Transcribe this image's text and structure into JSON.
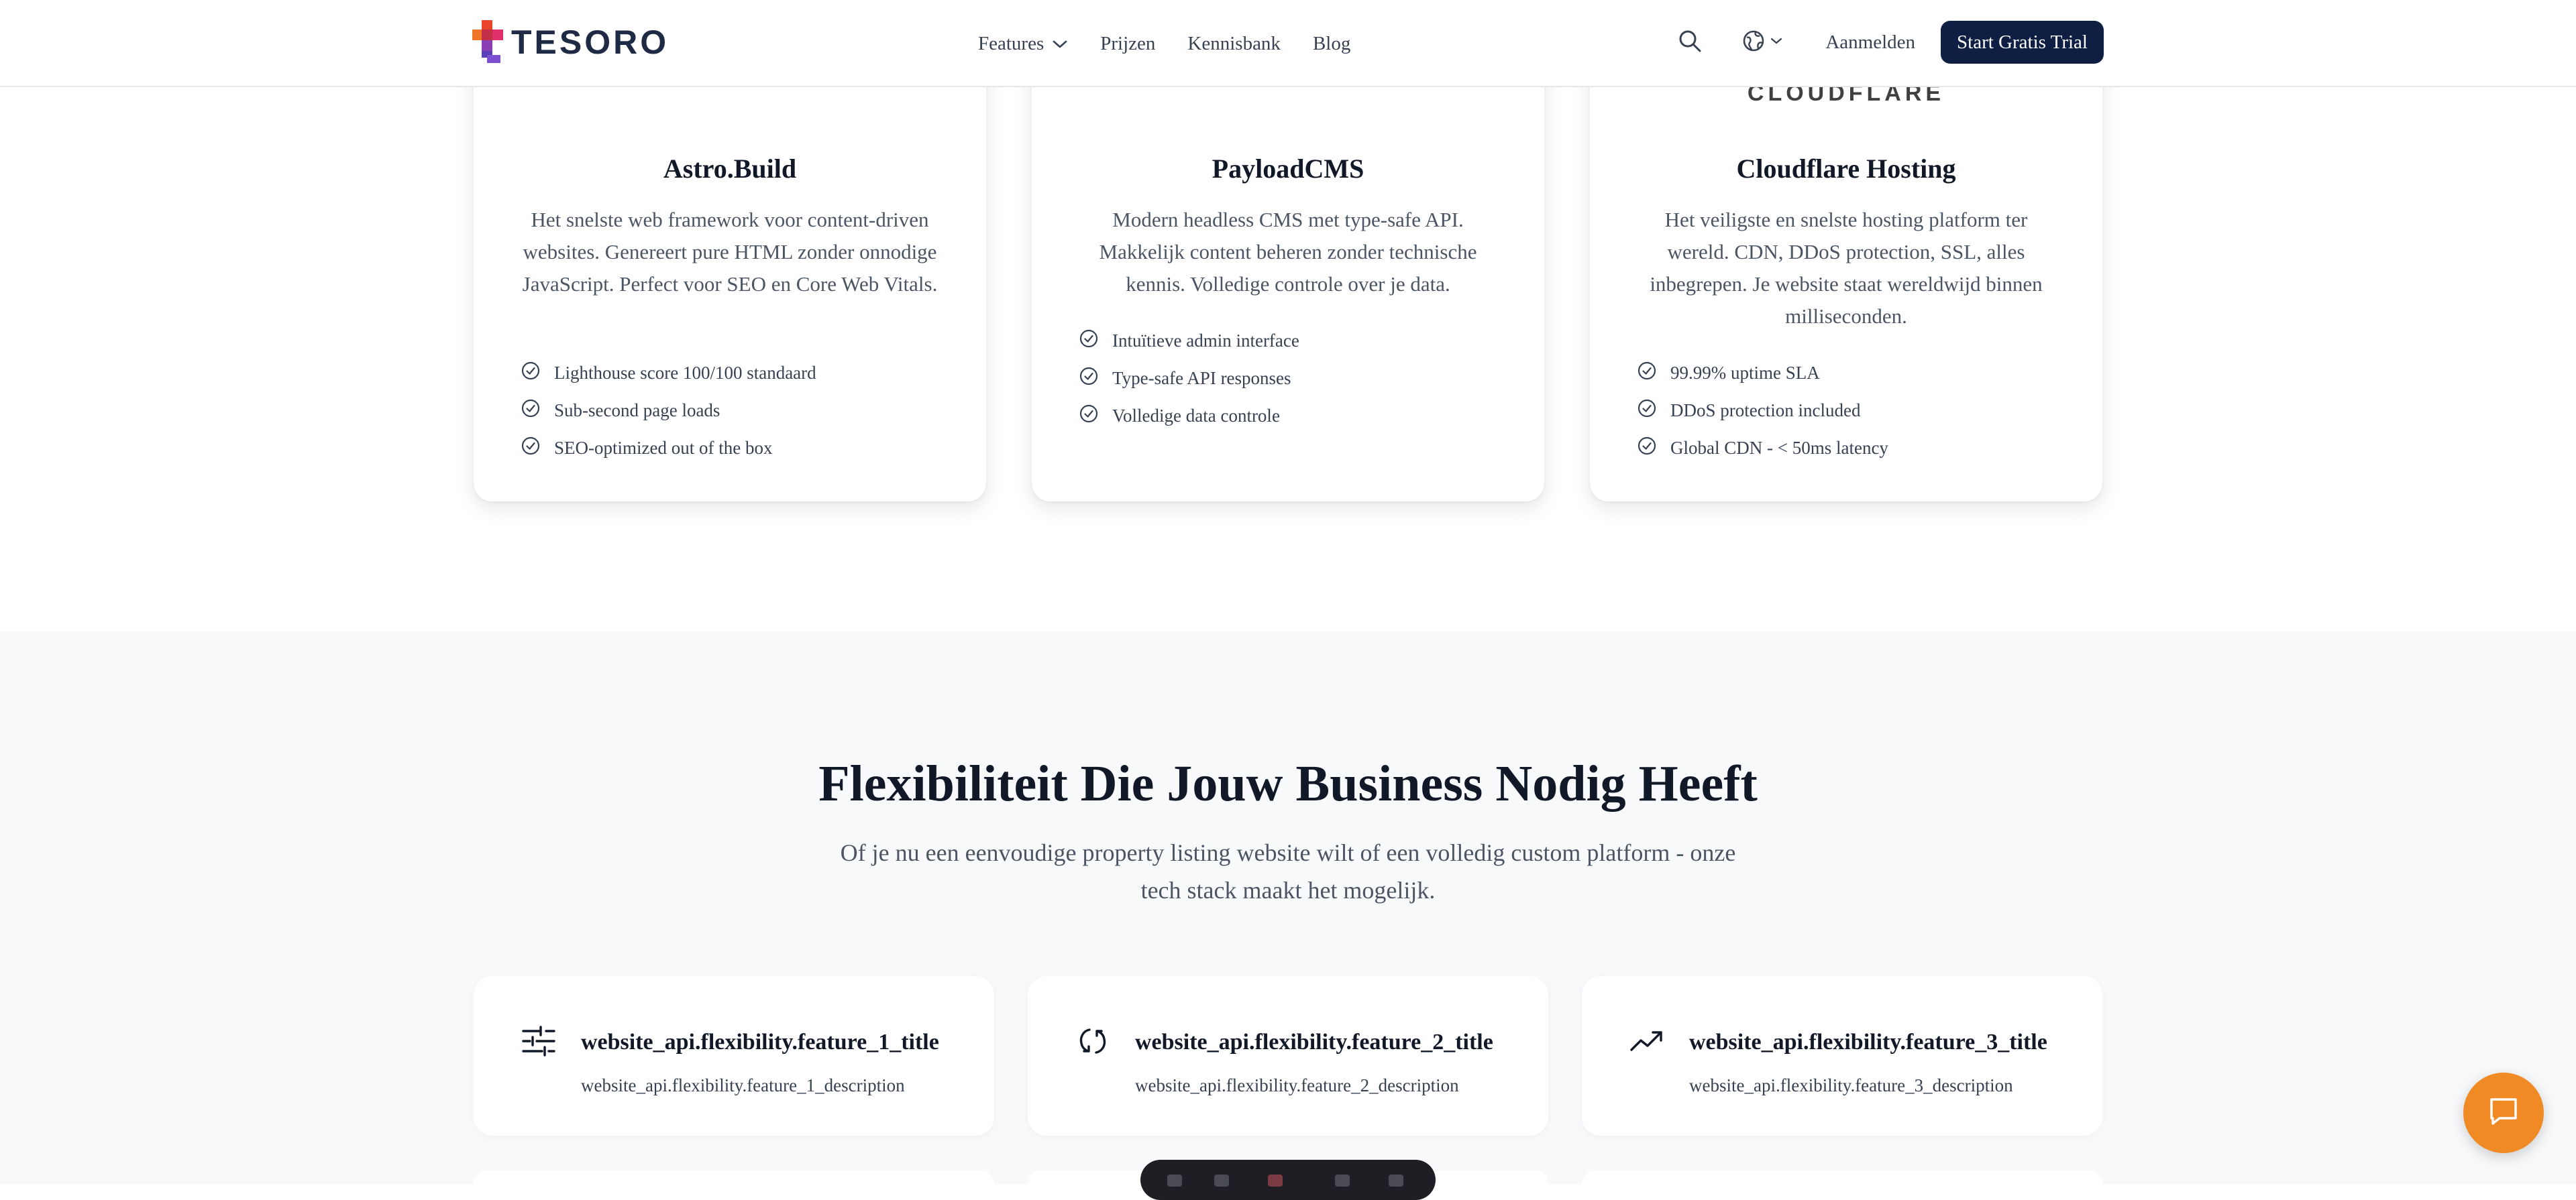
{
  "header": {
    "brand": "TESORO",
    "nav": [
      {
        "label": "Features",
        "has_dropdown": true
      },
      {
        "label": "Prijzen"
      },
      {
        "label": "Kennisbank"
      },
      {
        "label": "Blog"
      }
    ],
    "search_icon": "search-icon",
    "language_icon": "globe-icon",
    "login_label": "Aanmelden",
    "cta_label": "Start Gratis Trial"
  },
  "tech_cards": [
    {
      "title": "Astro.Build",
      "description": "Het snelste web framework voor content-driven websites. Genereert pure HTML zonder onnodige JavaScript. Perfect voor SEO en Core Web Vitals.",
      "features": [
        "Lighthouse score 100/100 standaard",
        "Sub-second page loads",
        "SEO-optimized out of the box"
      ]
    },
    {
      "title": "PayloadCMS",
      "description": "Modern headless CMS met type-safe API. Makkelijk content beheren zonder technische kennis. Volledige controle over je data.",
      "features": [
        "Intuïtieve admin interface",
        "Type-safe API responses",
        "Volledige data controle"
      ]
    },
    {
      "logo_text": "CLOUDFLARE",
      "title": "Cloudflare Hosting",
      "description": "Het veiligste en snelste hosting platform ter wereld. CDN, DDoS protection, SSL, alles inbegrepen. Je website staat wereldwijd binnen milliseconden.",
      "features": [
        "99.99% uptime SLA",
        "DDoS protection included",
        "Global CDN - < 50ms latency"
      ]
    }
  ],
  "flexibility": {
    "title": "Flexibiliteit Die Jouw Business Nodig Heeft",
    "subtitle": "Of je nu een eenvoudige property listing website wilt of een volledig custom platform - onze tech stack maakt het mogelijk.",
    "features": [
      {
        "icon": "sliders-icon",
        "title": "website_api.flexibility.feature_1_title",
        "description": "website_api.flexibility.feature_1_description"
      },
      {
        "icon": "refresh-icon",
        "title": "website_api.flexibility.feature_2_title",
        "description": "website_api.flexibility.feature_2_description"
      },
      {
        "icon": "trending-up-icon",
        "title": "website_api.flexibility.feature_3_title",
        "description": "website_api.flexibility.feature_3_description"
      }
    ]
  },
  "chat": {
    "icon": "chat-icon"
  },
  "colors": {
    "brand_navy": "#0f1f44",
    "accent_orange": "#f08a24",
    "section_bg": "#f8f9fb"
  }
}
